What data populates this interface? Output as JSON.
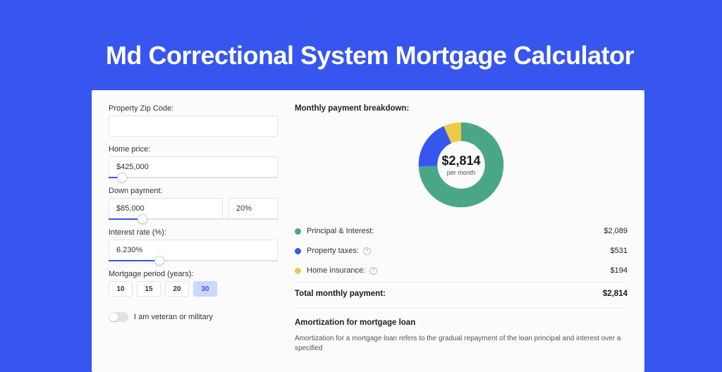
{
  "page": {
    "title": "Md Correctional System Mortgage Calculator"
  },
  "colors": {
    "accent": "#3656ef",
    "green": "#4aa785",
    "blue": "#3656ef",
    "yellow": "#f0c94a"
  },
  "form": {
    "zip": {
      "label": "Property Zip Code:",
      "value": ""
    },
    "home_price": {
      "label": "Home price:",
      "value": "$425,000",
      "slider_pct": 8
    },
    "down_payment": {
      "label": "Down payment:",
      "value": "$85,000",
      "pct": "20%",
      "slider_pct": 20
    },
    "interest": {
      "label": "Interest rate (%):",
      "value": "6.230%",
      "slider_pct": 30
    },
    "period": {
      "label": "Mortgage period (years):",
      "options": [
        "10",
        "15",
        "20",
        "30"
      ],
      "selected": "30"
    },
    "veteran": {
      "label": "I am veteran or military",
      "value": false
    }
  },
  "breakdown": {
    "title": "Monthly payment breakdown:",
    "donut": {
      "amount": "$2,814",
      "per": "per month",
      "segments": [
        {
          "name": "Principal & Interest",
          "color": "green",
          "pct": 74.2
        },
        {
          "name": "Property taxes",
          "color": "blue",
          "pct": 18.9
        },
        {
          "name": "Home insurance",
          "color": "yellow",
          "pct": 6.9
        }
      ]
    },
    "lines": [
      {
        "dot": "green",
        "label": "Principal & Interest:",
        "info": false,
        "value": "$2,089"
      },
      {
        "dot": "blue",
        "label": "Property taxes:",
        "info": true,
        "value": "$531"
      },
      {
        "dot": "yellow",
        "label": "Home insurance:",
        "info": true,
        "value": "$194"
      }
    ],
    "total": {
      "label": "Total monthly payment:",
      "value": "$2,814"
    }
  },
  "amortization": {
    "title": "Amortization for mortgage loan",
    "text": "Amortization for a mortgage loan refers to the gradual repayment of the loan principal and interest over a specified"
  },
  "chart_data": {
    "type": "pie",
    "title": "Monthly payment breakdown",
    "series": [
      {
        "name": "Principal & Interest",
        "value": 2089,
        "color": "#4aa785"
      },
      {
        "name": "Property taxes",
        "value": 531,
        "color": "#3656ef"
      },
      {
        "name": "Home insurance",
        "value": 194,
        "color": "#f0c94a"
      }
    ],
    "total": 2814,
    "unit": "USD/month"
  }
}
